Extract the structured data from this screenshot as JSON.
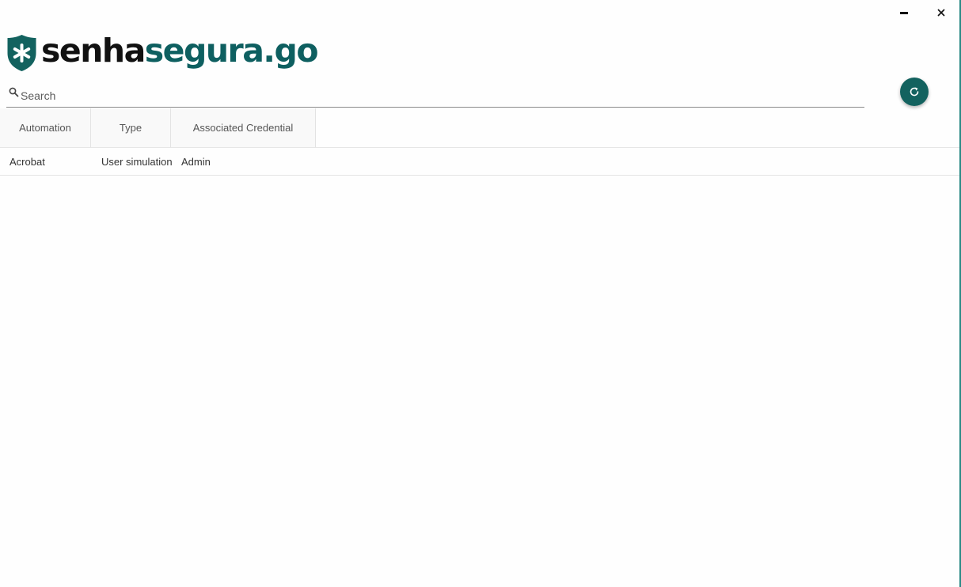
{
  "window": {
    "minimize_icon": "minimize-icon",
    "close_icon": "close-icon"
  },
  "brand": {
    "name_part1": "senha",
    "name_part2": "segura.go",
    "logo_icon": "shield-asterisk-icon",
    "colors": {
      "dark_text": "#111111",
      "accent": "#0e5f60"
    }
  },
  "search": {
    "placeholder": "Search",
    "value": "",
    "icon": "search-icon"
  },
  "refresh_button": {
    "icon": "refresh-icon",
    "color": "#13625f"
  },
  "table": {
    "columns": [
      "Automation",
      "Type",
      "Associated Credential"
    ],
    "rows": [
      {
        "automation": "Acrobat",
        "type": "User simulation",
        "credential": "Admin"
      }
    ]
  }
}
